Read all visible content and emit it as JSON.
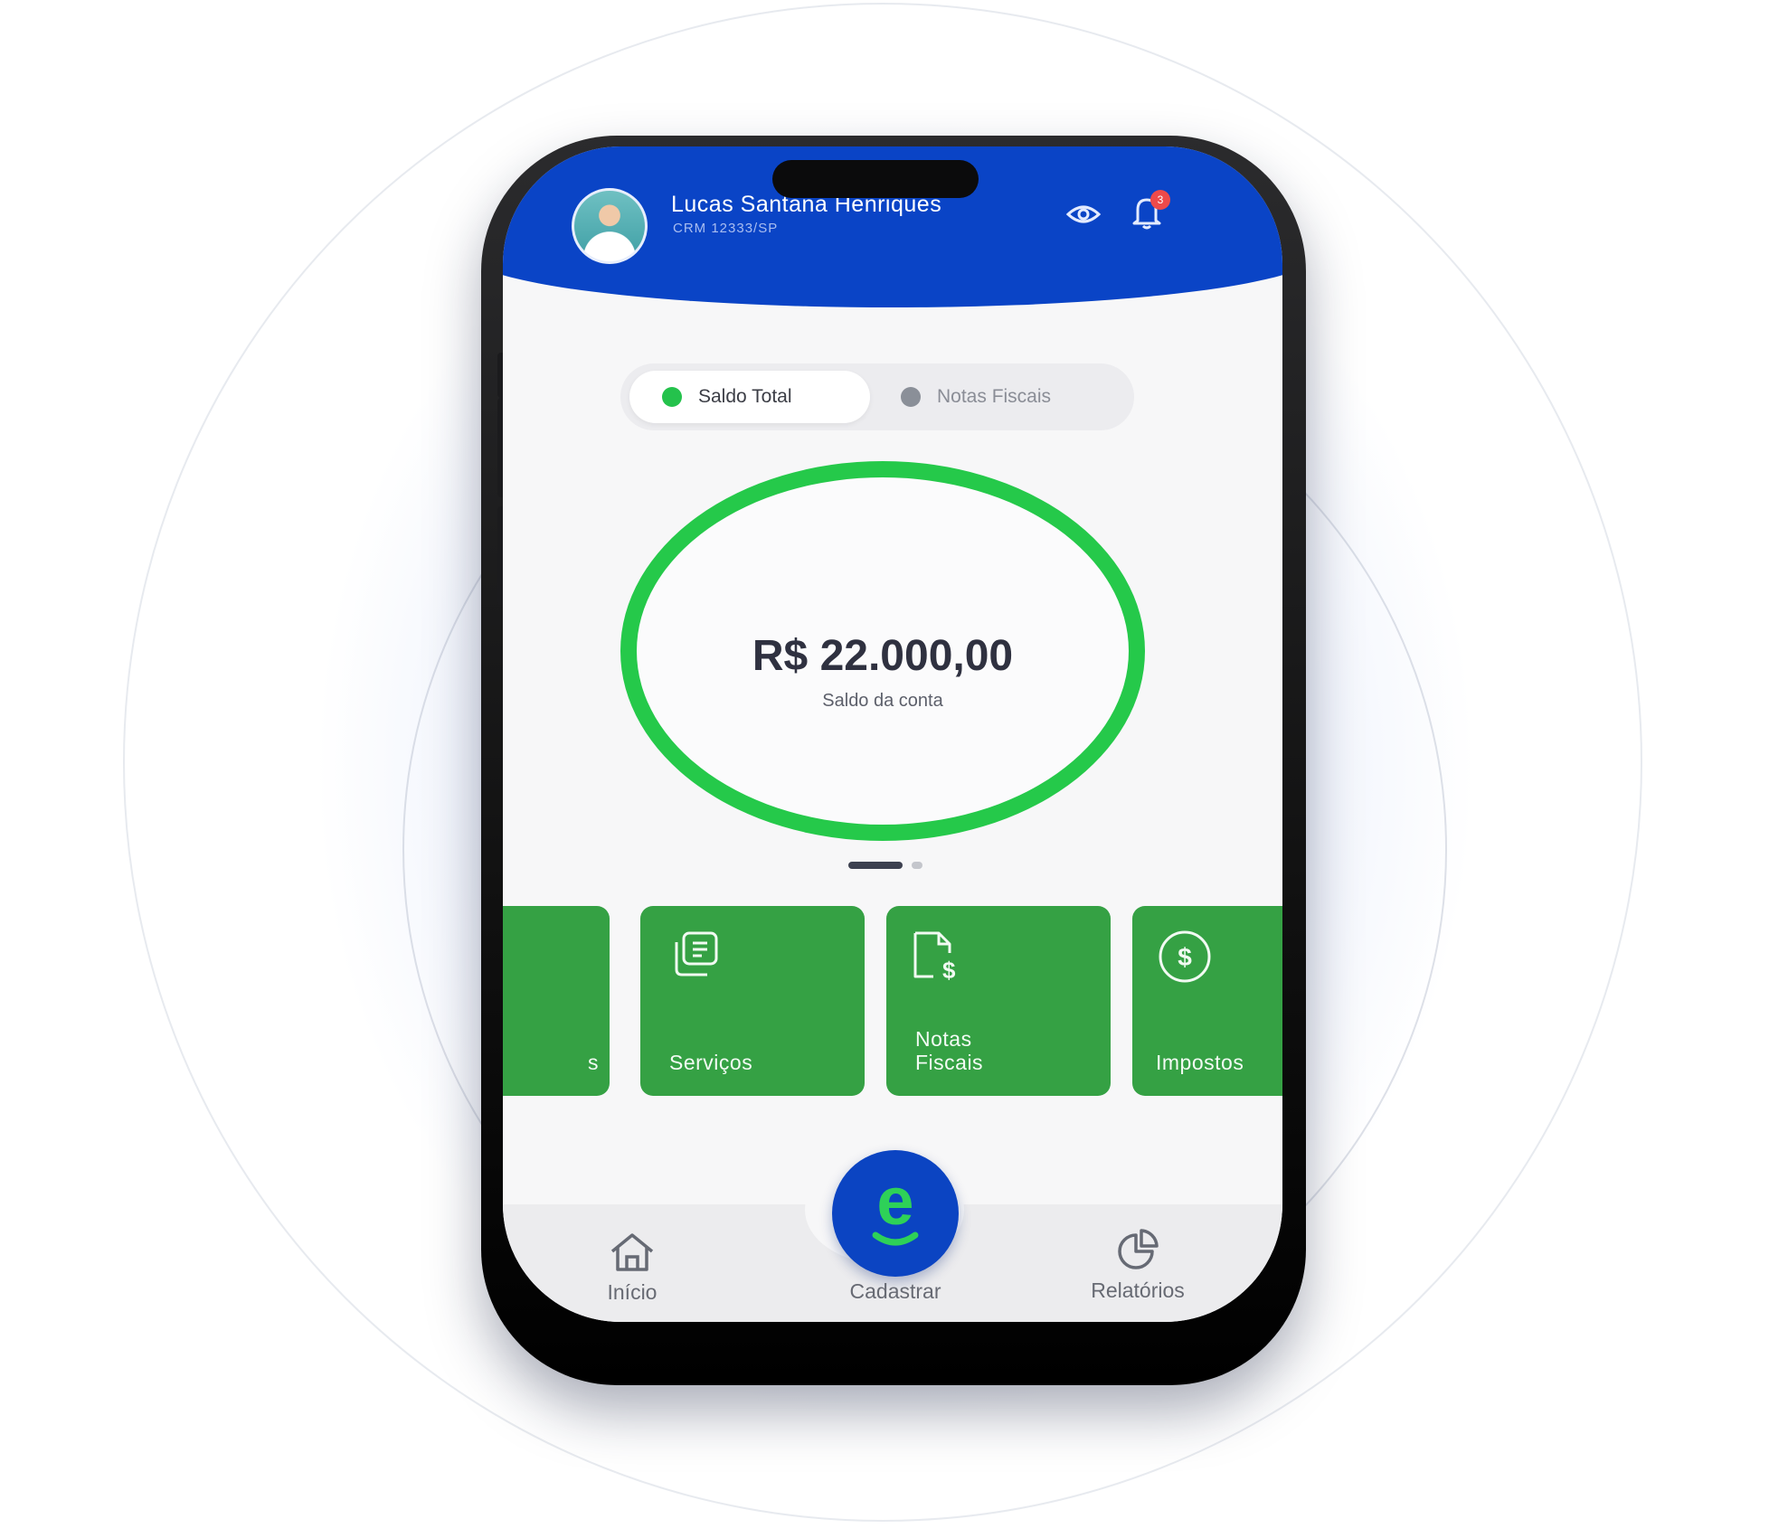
{
  "header": {
    "user_name": "Lucas Santana Henriques",
    "user_crm": "CRM 12333/SP",
    "notification_count": "3"
  },
  "balance_toggle": {
    "options": [
      {
        "label": "Saldo Total",
        "selected": true
      },
      {
        "label": "Notas Fiscais",
        "selected": false
      }
    ]
  },
  "balance": {
    "value": "R$ 22.000,00",
    "label": "Saldo da conta"
  },
  "carousel": {
    "active_page": 1,
    "page_count": 2
  },
  "cards": [
    {
      "label": "s",
      "icon": "unknown-icon"
    },
    {
      "label": "Serviços",
      "icon": "documents-icon"
    },
    {
      "label": "Notas\nFiscais",
      "icon": "invoice-dollar-icon"
    },
    {
      "label": "Impostos",
      "icon": "dollar-circle-icon"
    }
  ],
  "bottom_nav": {
    "items": [
      {
        "label": "Início",
        "icon": "home-icon"
      },
      {
        "label": "Cadastrar",
        "icon": "brand-e-icon"
      },
      {
        "label": "Relatórios",
        "icon": "pie-chart-icon"
      }
    ],
    "fab_letter": "e"
  },
  "colors": {
    "brand_blue": "#0a44c6",
    "brand_green": "#25c94a",
    "card_green": "#35a144",
    "badge_red": "#ee4a4a"
  }
}
